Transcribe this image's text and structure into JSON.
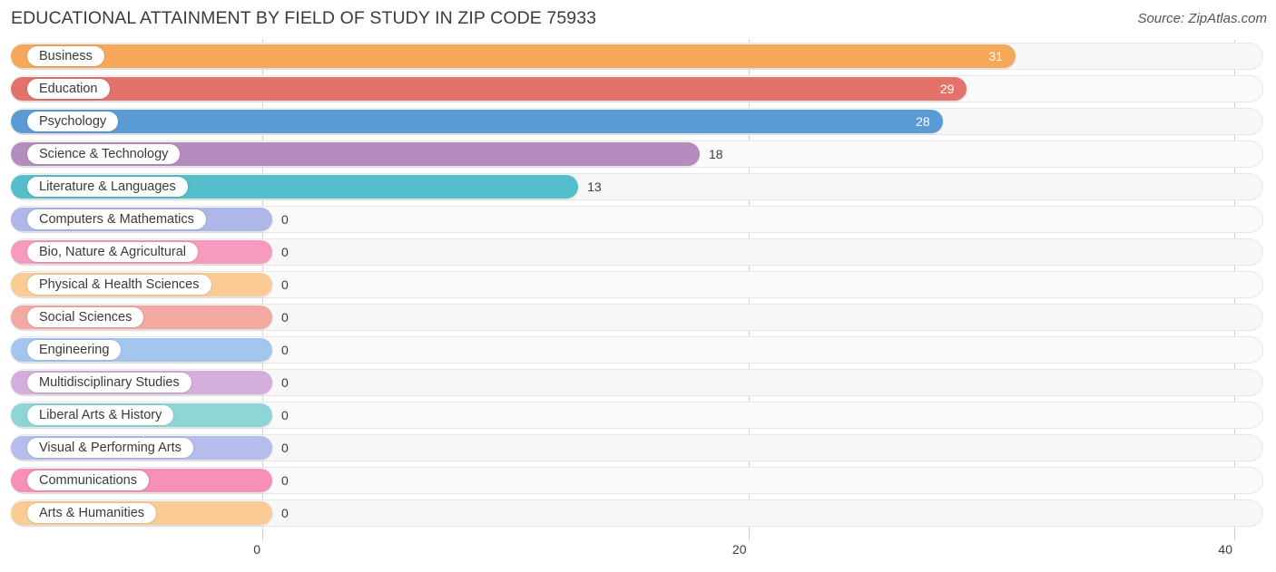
{
  "header": {
    "title": "EDUCATIONAL ATTAINMENT BY FIELD OF STUDY IN ZIP CODE 75933",
    "source": "Source: ZipAtlas.com"
  },
  "chart_data": {
    "type": "bar",
    "orientation": "horizontal",
    "title": "EDUCATIONAL ATTAINMENT BY FIELD OF STUDY IN ZIP CODE 75933",
    "subtitle": "",
    "xlabel": "",
    "ylabel": "",
    "xlim": [
      0,
      40
    ],
    "xticks": [
      0,
      20,
      40
    ],
    "xtick_labels": [
      "0",
      "20",
      "40"
    ],
    "grid": true,
    "legend": false,
    "categories": [
      "Business",
      "Education",
      "Psychology",
      "Science & Technology",
      "Literature & Languages",
      "Computers & Mathematics",
      "Bio, Nature & Agricultural",
      "Physical & Health Sciences",
      "Social Sciences",
      "Engineering",
      "Multidisciplinary Studies",
      "Liberal Arts & History",
      "Visual & Performing Arts",
      "Communications",
      "Arts & Humanities"
    ],
    "values": [
      31,
      29,
      28,
      18,
      13,
      0,
      0,
      0,
      0,
      0,
      0,
      0,
      0,
      0,
      0
    ],
    "value_labels": [
      "31",
      "29",
      "28",
      "18",
      "13",
      "0",
      "0",
      "0",
      "0",
      "0",
      "0",
      "0",
      "0",
      "0",
      "0"
    ],
    "bar_colors": [
      "#f6a85a",
      "#e3726b",
      "#5b9bd5",
      "#b58cbf",
      "#54becb",
      "#aeb8e8",
      "#f79ac0",
      "#fbcb95",
      "#f3a9a2",
      "#a3c6ef",
      "#d3addb",
      "#8ed6d6",
      "#b4bdeb",
      "#f78fb8",
      "#fbcb95"
    ]
  },
  "axis": {
    "ticks": [
      {
        "label": "0",
        "value": 0
      },
      {
        "label": "20",
        "value": 20
      },
      {
        "label": "40",
        "value": 40
      }
    ]
  }
}
